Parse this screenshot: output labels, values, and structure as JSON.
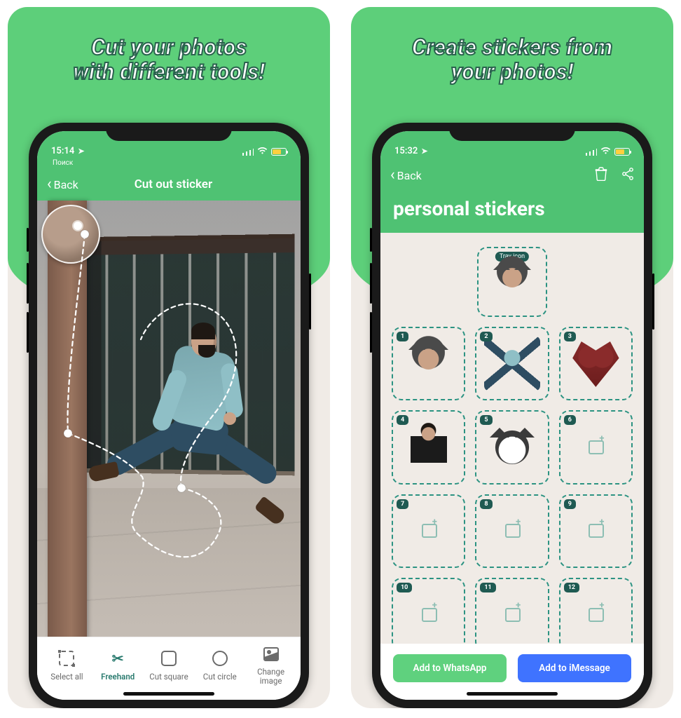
{
  "card1": {
    "headline_l1": "Cut your photos",
    "headline_l2": "with different tools!",
    "status": {
      "time": "15:14",
      "sub": "Поиск"
    },
    "nav": {
      "back": "Back",
      "title": "Cut out sticker"
    },
    "tools": {
      "select_all": "Select all",
      "freehand": "Freehand",
      "cut_square": "Cut square",
      "cut_circle": "Cut circle",
      "change_image_l1": "Change",
      "change_image_l2": "image"
    }
  },
  "card2": {
    "headline_l1": "Create stickers from",
    "headline_l2": "your photos!",
    "status": {
      "time": "15:32"
    },
    "nav": {
      "back": "Back"
    },
    "big_title": "personal stickers",
    "tray_label": "Tray icon",
    "slots": [
      "1",
      "2",
      "3",
      "4",
      "5",
      "6",
      "7",
      "8",
      "9",
      "10",
      "11",
      "12"
    ],
    "btn_wa": "Add to WhatsApp",
    "btn_im": "Add to iMessage"
  }
}
